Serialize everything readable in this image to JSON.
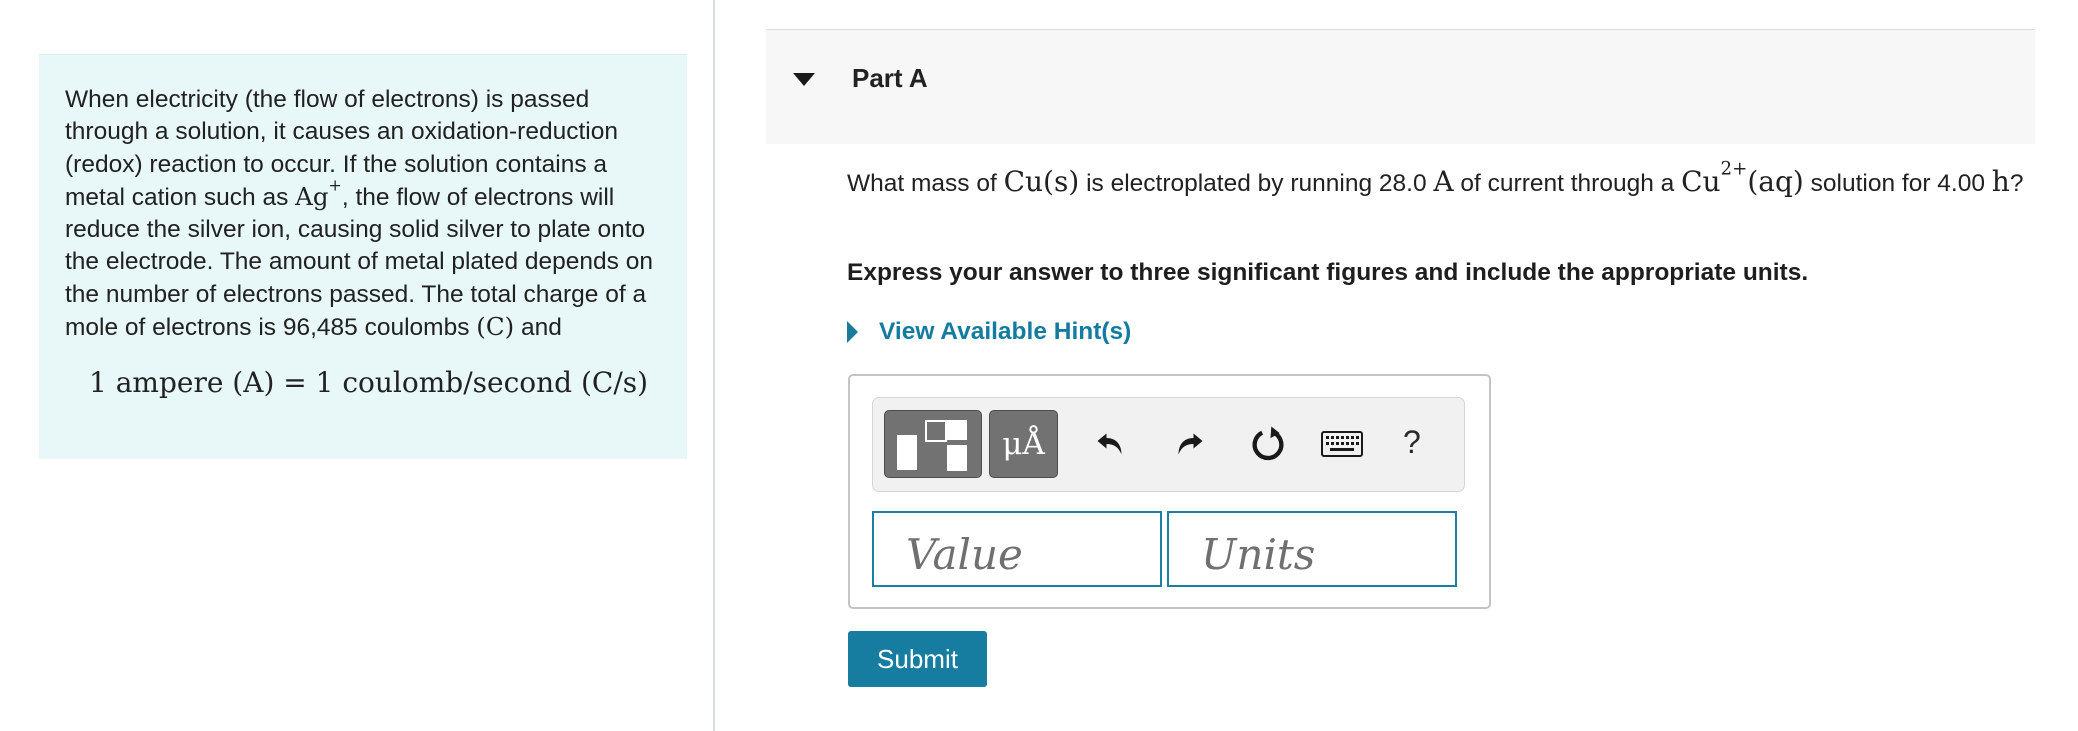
{
  "info": {
    "text_1": "When electricity (the flow of electrons) is passed through a solution, it causes an oxidation-reduction (redox) reaction to occur. If the solution contains a metal cation such as ",
    "ion_symbol": "Ag",
    "ion_charge": "+",
    "text_2": ", the flow of electrons will reduce the silver ion, causing solid silver to plate onto the electrode. The amount of metal plated depends on the number of electrons passed. The total charge of a mole of electrons is 96,485 coulombs ",
    "coulomb_symbol": "(C)",
    "text_3": " and",
    "equation": "1 ampere (A) = 1 coulomb/second (C/s)"
  },
  "part": {
    "title": "Part A"
  },
  "question": {
    "text_1": "What mass of ",
    "species_1": "Cu(s)",
    "text_2": " is electroplated by running 28.0 ",
    "unit_ampere": "A",
    "text_3": " of current through a ",
    "species_2": "Cu",
    "species_2_charge": "2+",
    "species_2_state": "(aq)",
    "text_4": " solution for 4.00 ",
    "unit_hour": "h",
    "text_5": "?",
    "instruction": "Express your answer to three significant figures and include the appropriate units.",
    "hint_link": "View Available Hint(s)"
  },
  "answer": {
    "value_placeholder": "Value",
    "units_placeholder": "Units",
    "units_tool_label": "μÅ",
    "help_label": "?",
    "submit_label": "Submit"
  },
  "colors": {
    "info_bg": "#e8f8f8",
    "accent": "#167ca0",
    "toolbar_button": "#727272"
  },
  "icons": [
    "templates-icon",
    "units-icon",
    "undo-icon",
    "redo-icon",
    "reset-icon",
    "keyboard-icon",
    "help-icon"
  ]
}
